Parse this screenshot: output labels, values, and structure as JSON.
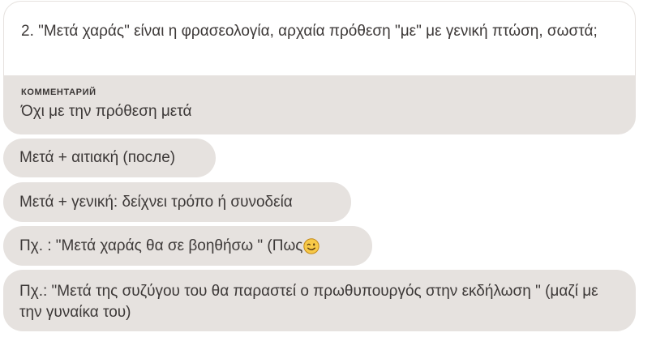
{
  "quoted": {
    "question": "2. \"Μετά χαράς\" είναι η φρασεολογία, αρχαία πρόθεση \"με\" με γενική πτώση, σωστά;",
    "comment_label": "КОММЕНТАРИЙ",
    "comment_text": "Όχι με την πρόθεση μετά"
  },
  "messages": [
    {
      "text": "Μετά + αιτιακή (после)"
    },
    {
      "text": "Μετά + γενική: δείχνει τρόπο ή συνοδεία"
    },
    {
      "text": "Πχ. : \"Μετά χαράς θα σε βοηθήσω \" (Πως",
      "emoji": "winking-face"
    },
    {
      "text": "Πχ.: \"Μετά της συζύγου του θα παραστεί ο πρωθυπουργός στην εκδήλωση \" (μαζί με την γυναίκα του)"
    }
  ],
  "colors": {
    "bubble_background": "#e6e2df",
    "card_top_background": "#ffffff",
    "text": "#3d3938",
    "emoji_face": "#f7c948",
    "emoji_outline": "#c48a1a"
  }
}
